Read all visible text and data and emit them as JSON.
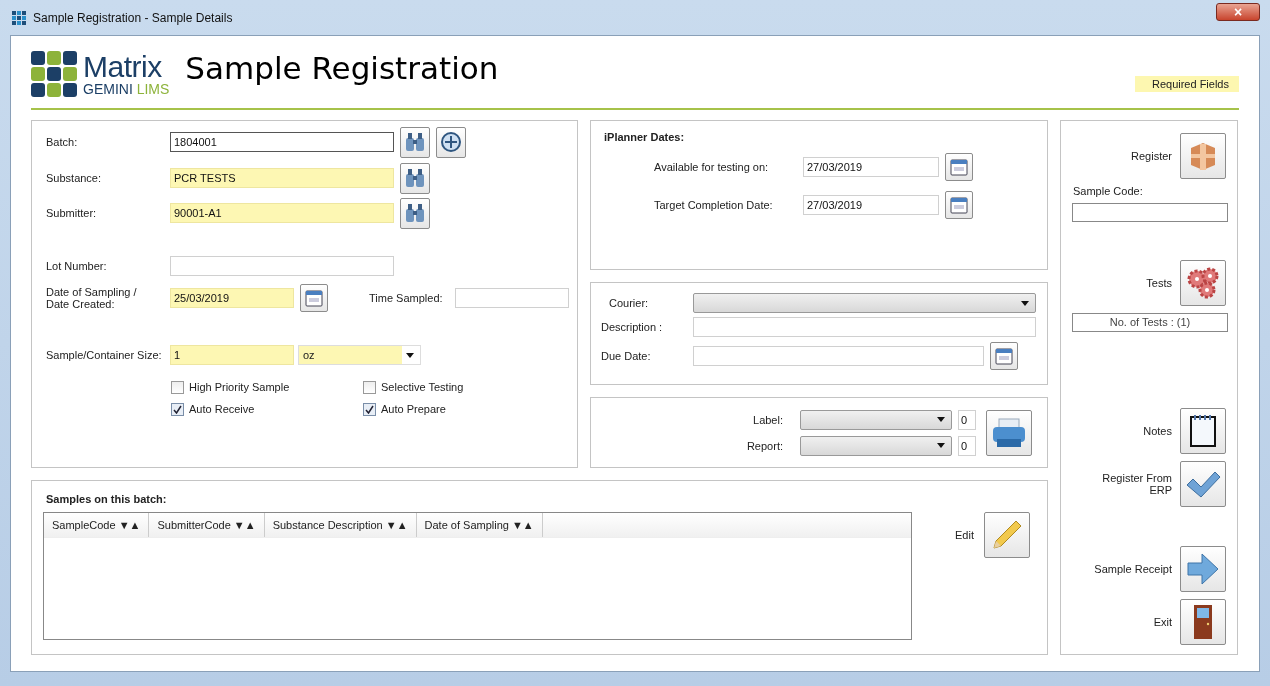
{
  "window": {
    "title": "Sample Registration - Sample Details",
    "close": "×"
  },
  "header": {
    "logo_word": "Matrix",
    "logo_sub": "GEMINI",
    "logo_sub2": "LIMS",
    "title": "Sample Registration",
    "legend": "Required Fields"
  },
  "sample_form": {
    "batch": {
      "label": "Batch:",
      "value": "1804001",
      "required": false
    },
    "substance": {
      "label": "Substance:",
      "value": "PCR TESTS",
      "required": true
    },
    "submitter": {
      "label": "Submitter:",
      "value": "90001-A1",
      "required": true
    },
    "lot_number": {
      "label": "Lot Number:",
      "required": false
    },
    "date_sampled": {
      "label": "Date of Sampling / Date Created:",
      "value": "25/03/2019",
      "required": true
    },
    "time_sampled": {
      "label": "Time Sampled:"
    },
    "size": {
      "label": "Sample/Container Size:",
      "value": "1",
      "unit": "oz",
      "required": true
    },
    "options": [
      {
        "label": "High Priority Sample",
        "checked": false
      },
      {
        "label": "Selective Testing",
        "checked": false
      },
      {
        "label": "Auto Receive",
        "checked": true
      },
      {
        "label": "Auto Prepare",
        "checked": true
      }
    ]
  },
  "iplanner": {
    "title": "iPlanner Dates:",
    "fields": [
      {
        "label": "Available for testing on:",
        "value": "27/03/2019"
      },
      {
        "label": "Target Completion Date:",
        "value": "27/03/2019"
      }
    ]
  },
  "shipping": {
    "courier": {
      "label": "Courier:"
    },
    "description": {
      "label": "Description :"
    },
    "due_date": {
      "label": "Due Date:"
    }
  },
  "printing": {
    "rows": [
      {
        "label": "Label:",
        "copies": "0"
      },
      {
        "label": "Report:",
        "copies": "0"
      }
    ]
  },
  "samples": {
    "title": "Samples on this batch:",
    "columns": [
      {
        "label": "SampleCode",
        "sort": "▼▲"
      },
      {
        "label": "SubmitterCode",
        "sort": "▼▲"
      },
      {
        "label": "Substance Description",
        "sort": "▼▲"
      },
      {
        "label": "Date of Sampling",
        "sort": "▼▲"
      }
    ],
    "edit": "Edit"
  },
  "actions": [
    {
      "kind": "register",
      "label": "Register"
    },
    {
      "kind": "sample_code",
      "label": "Sample Code:"
    },
    {
      "kind": "tests",
      "label": "Tests"
    },
    {
      "kind": "test_count",
      "label": "No. of Tests : (1)"
    },
    {
      "kind": "notes",
      "label": "Notes"
    },
    {
      "kind": "erp",
      "label": "Register From ERP"
    },
    {
      "kind": "receipt",
      "label": "Sample Receipt"
    },
    {
      "kind": "exit",
      "label": "Exit"
    }
  ]
}
